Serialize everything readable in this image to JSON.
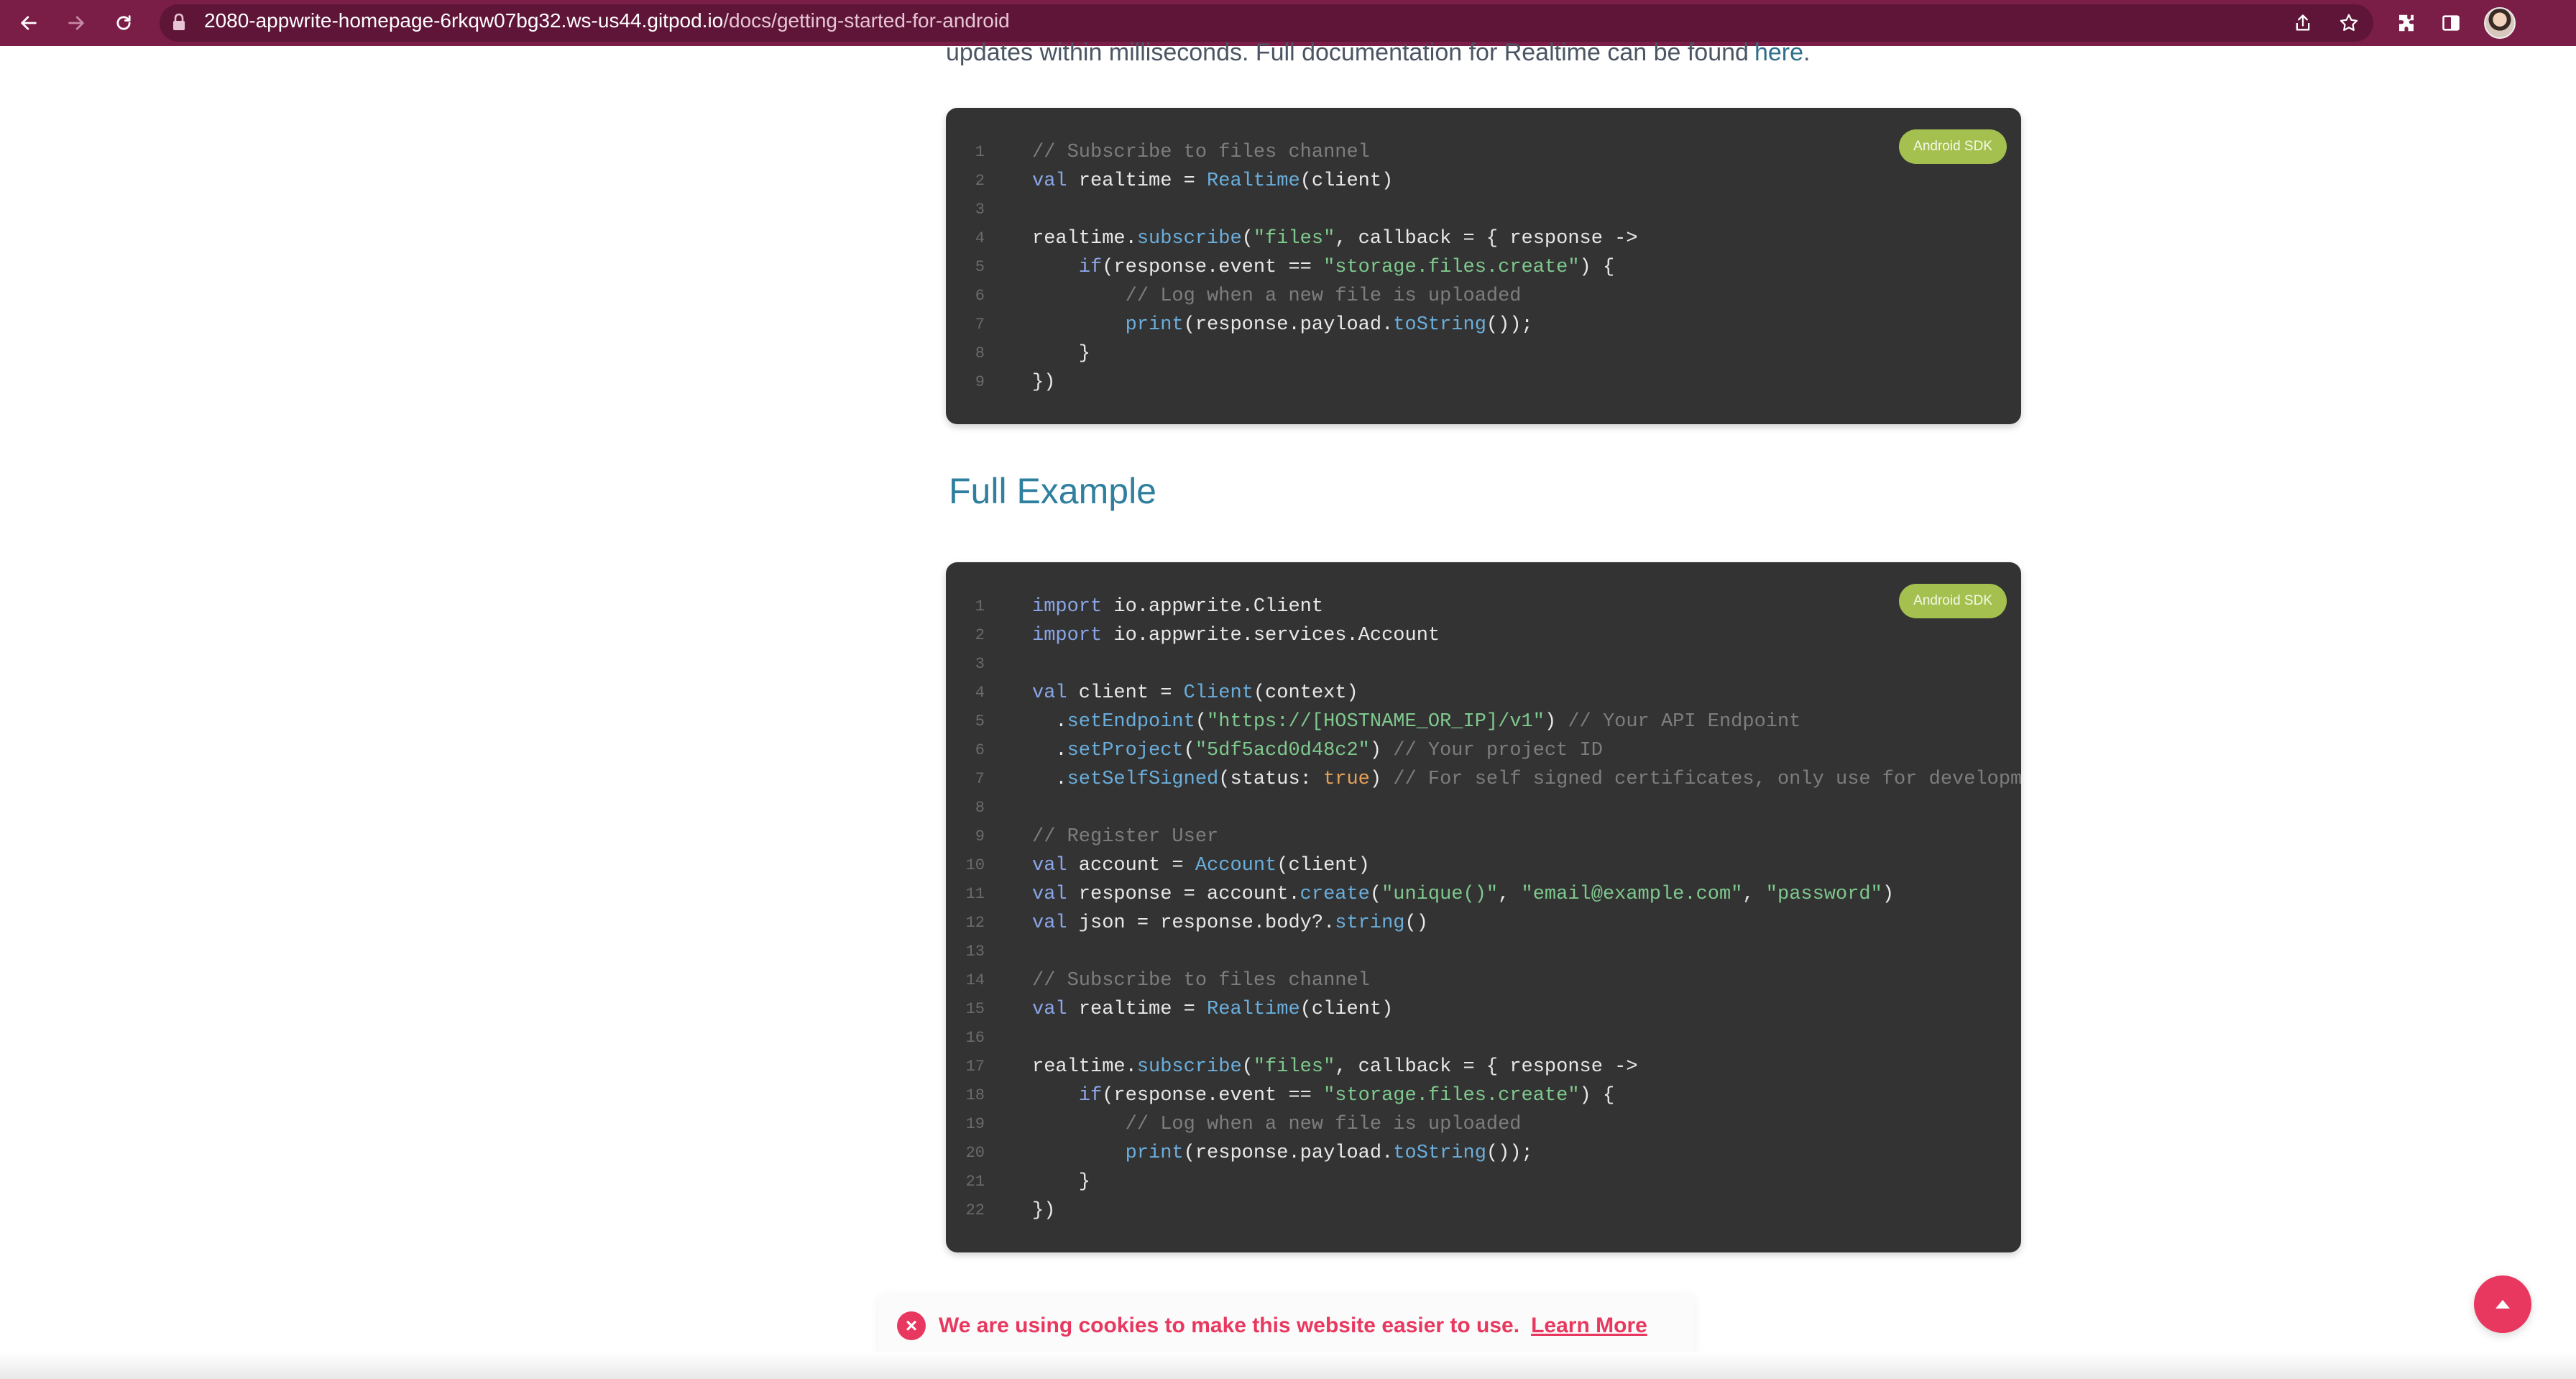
{
  "browser": {
    "url_host": "2080-appwrite-homepage-6rkqw07bg32.ws-us44.gitpod.io",
    "url_path": "/docs/getting-started-for-android"
  },
  "intro": {
    "text": "updates within milliseconds. Full documentation for Realtime can be found",
    "link": "here",
    "tail": "."
  },
  "code_blocks": [
    {
      "badge": "Android SDK",
      "lines": [
        [
          {
            "t": "// Subscribe to files channel",
            "c": "cmt"
          }
        ],
        [
          {
            "t": "val",
            "c": "kw"
          },
          {
            "t": " realtime = "
          },
          {
            "t": "Realtime",
            "c": "fn"
          },
          {
            "t": "(client)"
          }
        ],
        [],
        [
          {
            "t": "realtime."
          },
          {
            "t": "subscribe",
            "c": "fn"
          },
          {
            "t": "("
          },
          {
            "t": "\"files\"",
            "c": "str"
          },
          {
            "t": ", callback = { response ->"
          }
        ],
        [
          {
            "t": "    "
          },
          {
            "t": "if",
            "c": "kw"
          },
          {
            "t": "(response.event == "
          },
          {
            "t": "\"storage.files.create\"",
            "c": "str"
          },
          {
            "t": ") {"
          }
        ],
        [
          {
            "t": "        "
          },
          {
            "t": "// Log when a new file is uploaded",
            "c": "cmt"
          }
        ],
        [
          {
            "t": "        "
          },
          {
            "t": "print",
            "c": "fn"
          },
          {
            "t": "(response.payload."
          },
          {
            "t": "toString",
            "c": "fn"
          },
          {
            "t": "());"
          }
        ],
        [
          {
            "t": "    }"
          }
        ],
        [
          {
            "t": "})"
          }
        ]
      ]
    },
    {
      "badge": "Android SDK",
      "lines": [
        [
          {
            "t": "import",
            "c": "kw"
          },
          {
            "t": " io.appwrite.Client"
          }
        ],
        [
          {
            "t": "import",
            "c": "kw"
          },
          {
            "t": " io.appwrite.services.Account"
          }
        ],
        [],
        [
          {
            "t": "val",
            "c": "kw"
          },
          {
            "t": " client = "
          },
          {
            "t": "Client",
            "c": "fn"
          },
          {
            "t": "(context)"
          }
        ],
        [
          {
            "t": "  ."
          },
          {
            "t": "setEndpoint",
            "c": "fn"
          },
          {
            "t": "("
          },
          {
            "t": "\"https://[HOSTNAME_OR_IP]/v1\"",
            "c": "str"
          },
          {
            "t": ") "
          },
          {
            "t": "// Your API Endpoint",
            "c": "cmt"
          }
        ],
        [
          {
            "t": "  ."
          },
          {
            "t": "setProject",
            "c": "fn"
          },
          {
            "t": "("
          },
          {
            "t": "\"5df5acd0d48c2\"",
            "c": "str"
          },
          {
            "t": ") "
          },
          {
            "t": "// Your project ID",
            "c": "cmt"
          }
        ],
        [
          {
            "t": "  ."
          },
          {
            "t": "setSelfSigned",
            "c": "fn"
          },
          {
            "t": "(status: "
          },
          {
            "t": "true",
            "c": "bool"
          },
          {
            "t": ") "
          },
          {
            "t": "// For self signed certificates, only use for development",
            "c": "cmt"
          }
        ],
        [],
        [
          {
            "t": "// Register User",
            "c": "cmt"
          }
        ],
        [
          {
            "t": "val",
            "c": "kw"
          },
          {
            "t": " account = "
          },
          {
            "t": "Account",
            "c": "fn"
          },
          {
            "t": "(client)"
          }
        ],
        [
          {
            "t": "val",
            "c": "kw"
          },
          {
            "t": " response = account."
          },
          {
            "t": "create",
            "c": "fn"
          },
          {
            "t": "("
          },
          {
            "t": "\"unique()\"",
            "c": "str"
          },
          {
            "t": ", "
          },
          {
            "t": "\"email@example.com\"",
            "c": "str"
          },
          {
            "t": ", "
          },
          {
            "t": "\"password\"",
            "c": "str"
          },
          {
            "t": ")"
          }
        ],
        [
          {
            "t": "val",
            "c": "kw"
          },
          {
            "t": " json = response.body?."
          },
          {
            "t": "string",
            "c": "fn"
          },
          {
            "t": "()"
          }
        ],
        [],
        [
          {
            "t": "// Subscribe to files channel",
            "c": "cmt"
          }
        ],
        [
          {
            "t": "val",
            "c": "kw"
          },
          {
            "t": " realtime = "
          },
          {
            "t": "Realtime",
            "c": "fn"
          },
          {
            "t": "(client)"
          }
        ],
        [],
        [
          {
            "t": "realtime."
          },
          {
            "t": "subscribe",
            "c": "fn"
          },
          {
            "t": "("
          },
          {
            "t": "\"files\"",
            "c": "str"
          },
          {
            "t": ", callback = { response ->"
          }
        ],
        [
          {
            "t": "    "
          },
          {
            "t": "if",
            "c": "kw"
          },
          {
            "t": "(response.event == "
          },
          {
            "t": "\"storage.files.create\"",
            "c": "str"
          },
          {
            "t": ") {"
          }
        ],
        [
          {
            "t": "        "
          },
          {
            "t": "// Log when a new file is uploaded",
            "c": "cmt"
          }
        ],
        [
          {
            "t": "        "
          },
          {
            "t": "print",
            "c": "fn"
          },
          {
            "t": "(response.payload."
          },
          {
            "t": "toString",
            "c": "fn"
          },
          {
            "t": "());"
          }
        ],
        [
          {
            "t": "    }"
          }
        ],
        [
          {
            "t": "})"
          }
        ]
      ]
    }
  ],
  "section_heading": "Full Example",
  "cookie_banner": {
    "close_symbol": "×",
    "message": "We are using cookies to make this website easier to use.",
    "link": "Learn More"
  },
  "icons": {
    "back": "arrow-left-icon",
    "forward": "arrow-right-icon",
    "reload": "reload-icon",
    "lock": "lock-icon",
    "share": "share-icon",
    "bookmark": "star-icon",
    "extensions": "puzzle-icon",
    "side_panel": "side-panel-icon",
    "scroll_top": "chevron-up-icon"
  },
  "colors": {
    "toolbar": "#7a1d47",
    "code_background": "#333333",
    "badge": "#a4c150",
    "heading": "#2f7f9e",
    "cookie_accent": "#e8385f"
  }
}
